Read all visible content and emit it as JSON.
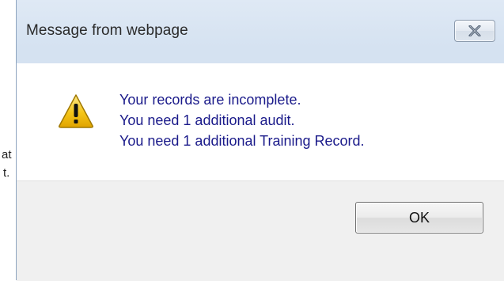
{
  "background_fragments": [
    "at",
    "t."
  ],
  "dialog": {
    "title": "Message from webpage",
    "close_icon": "close-icon",
    "warning_icon": "warning-icon",
    "message_lines": [
      "Your records are incomplete.",
      "You need 1 additional audit.",
      "You need 1 additional Training Record."
    ],
    "ok_label": "OK"
  },
  "colors": {
    "titlebar": "#d5e2f1",
    "message_text": "#1a1a8a",
    "footer": "#f0f0f0",
    "warning_fill": "#f5c518"
  }
}
